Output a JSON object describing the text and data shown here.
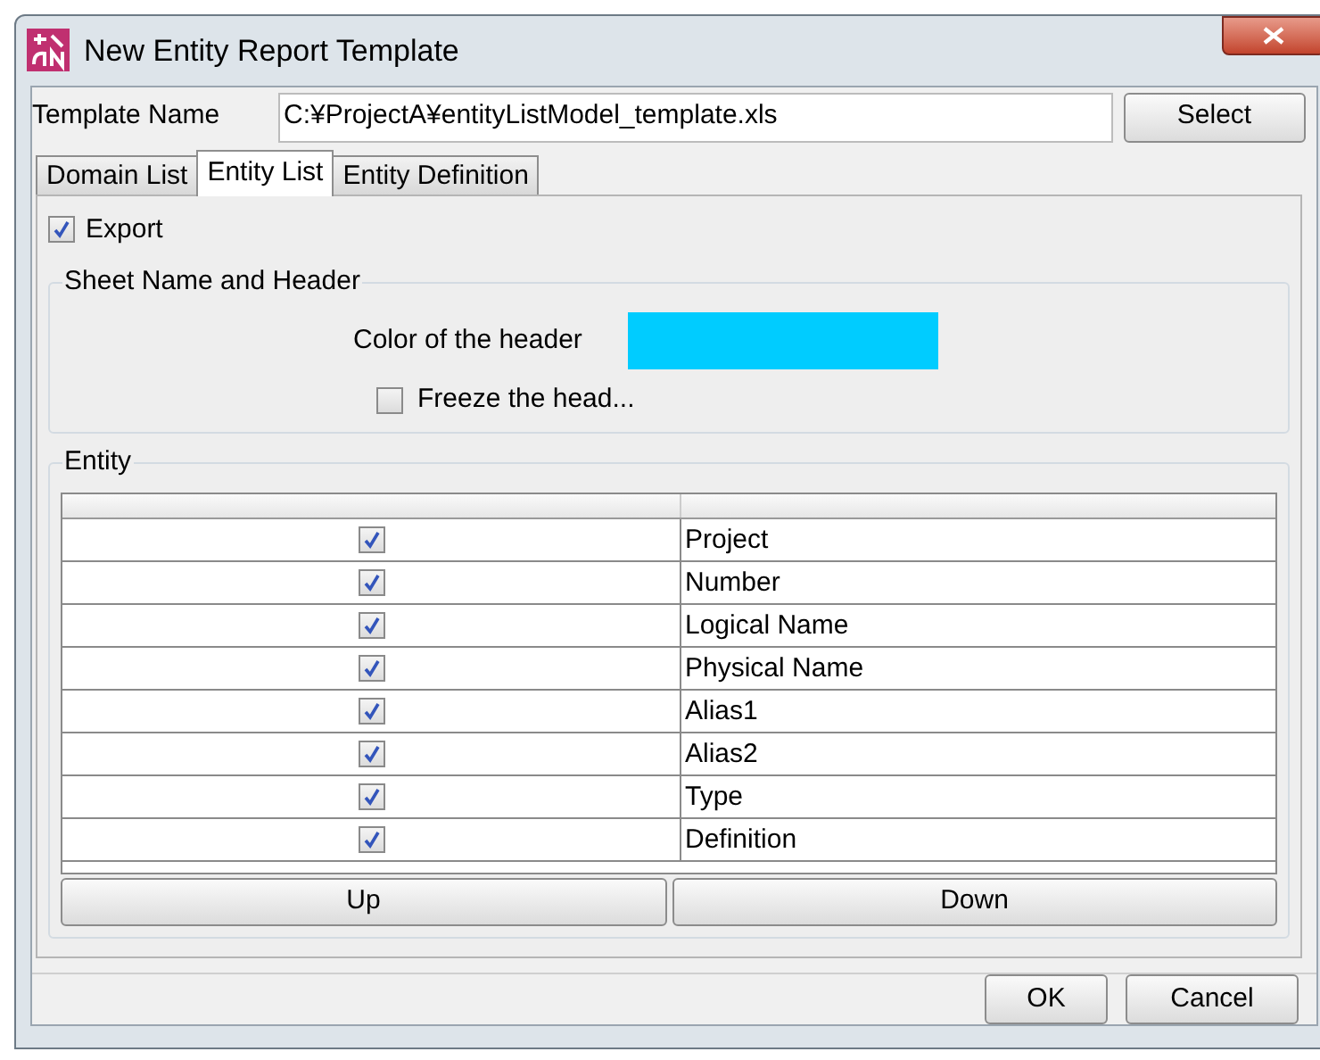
{
  "window": {
    "title": "New Entity Report Template"
  },
  "template_name": {
    "label": "Template Name",
    "value": "C:¥ProjectA¥entityListModel_template.xls",
    "button": "Select"
  },
  "tabs": [
    {
      "label": "Domain List",
      "selected": false
    },
    {
      "label": "Entity List",
      "selected": true
    },
    {
      "label": "Entity Definition",
      "selected": false
    }
  ],
  "export": {
    "label": "Export",
    "checked": true
  },
  "sheet_group": {
    "title": "Sheet Name and Header",
    "color_label": "Color of the header",
    "color": "#00ccff",
    "freeze": {
      "label": "Freeze the head...",
      "checked": false
    }
  },
  "entity_group": {
    "title": "Entity",
    "rows": [
      {
        "checked": true,
        "name": "Project"
      },
      {
        "checked": true,
        "name": "Number"
      },
      {
        "checked": true,
        "name": "Logical Name"
      },
      {
        "checked": true,
        "name": "Physical Name"
      },
      {
        "checked": true,
        "name": "Alias1"
      },
      {
        "checked": true,
        "name": "Alias2"
      },
      {
        "checked": true,
        "name": "Type"
      },
      {
        "checked": true,
        "name": "Definition"
      }
    ],
    "buttons": [
      "Up",
      "Down"
    ]
  },
  "buttons": [
    "OK",
    "Cancel"
  ]
}
